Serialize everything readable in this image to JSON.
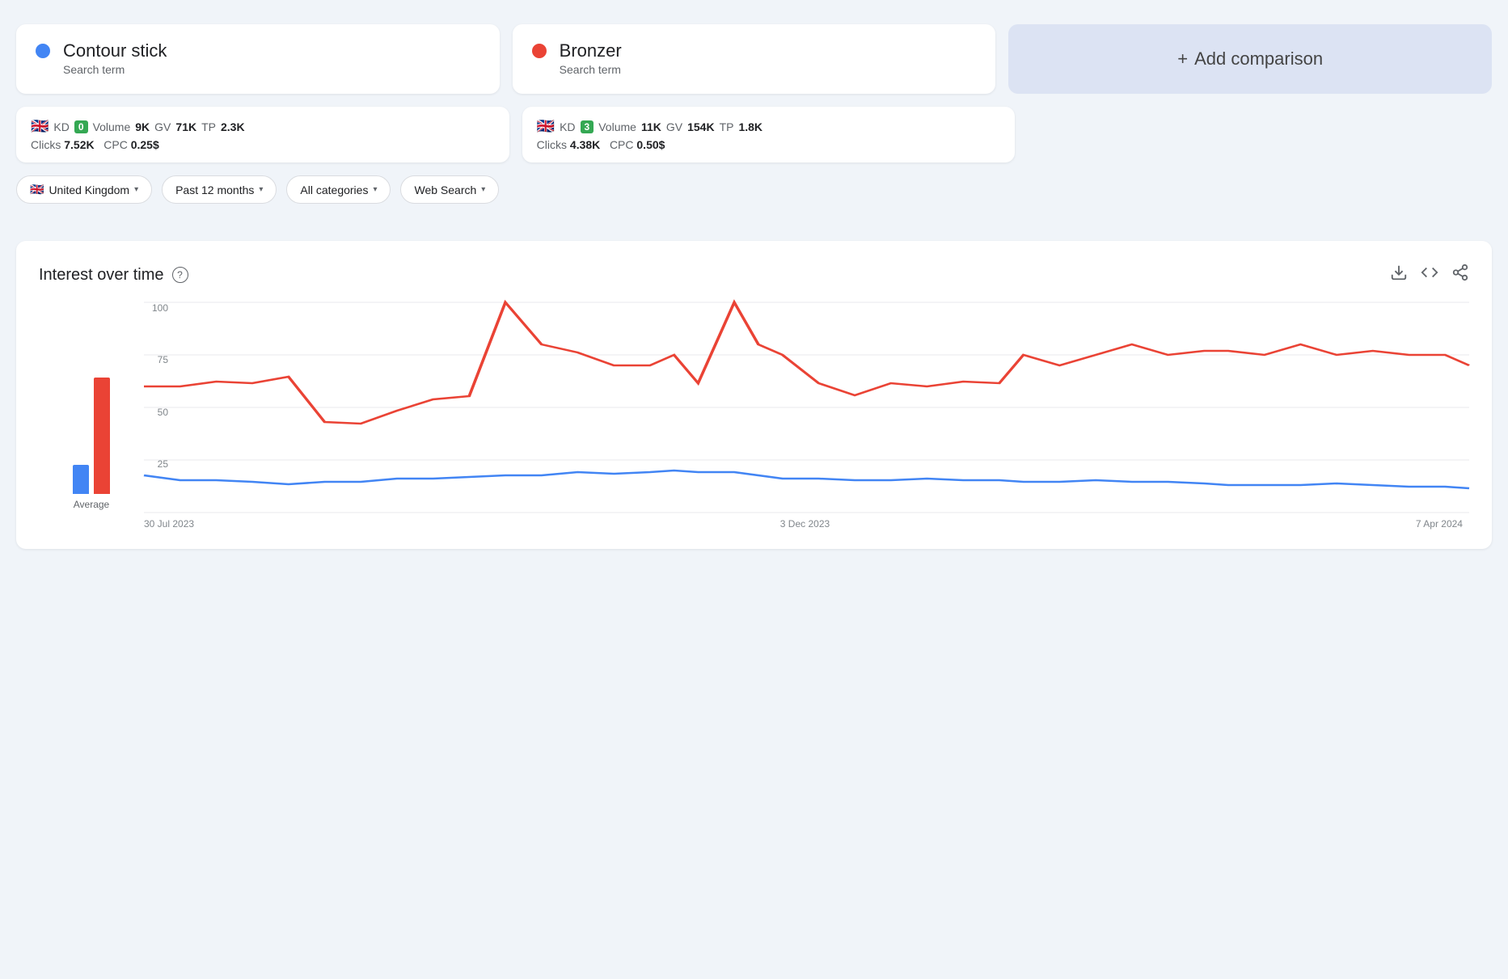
{
  "search_terms": [
    {
      "id": "contour-stick",
      "name": "Contour stick",
      "type": "Search term",
      "dot_color": "blue",
      "flag": "🇬🇧",
      "kd": "0",
      "kd_color": "#34a853",
      "volume": "9K",
      "gv": "71K",
      "tp": "2.3K",
      "clicks": "7.52K",
      "cpc": "0.25$"
    },
    {
      "id": "bronzer",
      "name": "Bronzer",
      "type": "Search term",
      "dot_color": "red",
      "flag": "🇬🇧",
      "kd": "3",
      "kd_color": "#34a853",
      "volume": "11K",
      "gv": "154K",
      "tp": "1.8K",
      "clicks": "4.38K",
      "cpc": "0.50$"
    }
  ],
  "add_comparison": {
    "label": "Add comparison",
    "plus": "+"
  },
  "filters": {
    "region": "United Kingdom",
    "period": "Past 12 months",
    "categories": "All categories",
    "search_type": "Web Search"
  },
  "chart": {
    "title": "Interest over time",
    "help_icon": "?",
    "actions": {
      "download": "⬇",
      "embed": "<>",
      "share": "⊹"
    },
    "y_axis": [
      "100",
      "75",
      "50",
      "25"
    ],
    "x_axis": [
      "30 Jul 2023",
      "3 Dec 2023",
      "7 Apr 2024"
    ],
    "bar_chart": {
      "label": "Average",
      "blue_height_pct": 18,
      "red_height_pct": 72
    }
  },
  "labels": {
    "kd": "KD",
    "volume": "Volume",
    "gv": "GV",
    "tp": "TP",
    "clicks": "Clicks",
    "cpc": "CPC"
  }
}
